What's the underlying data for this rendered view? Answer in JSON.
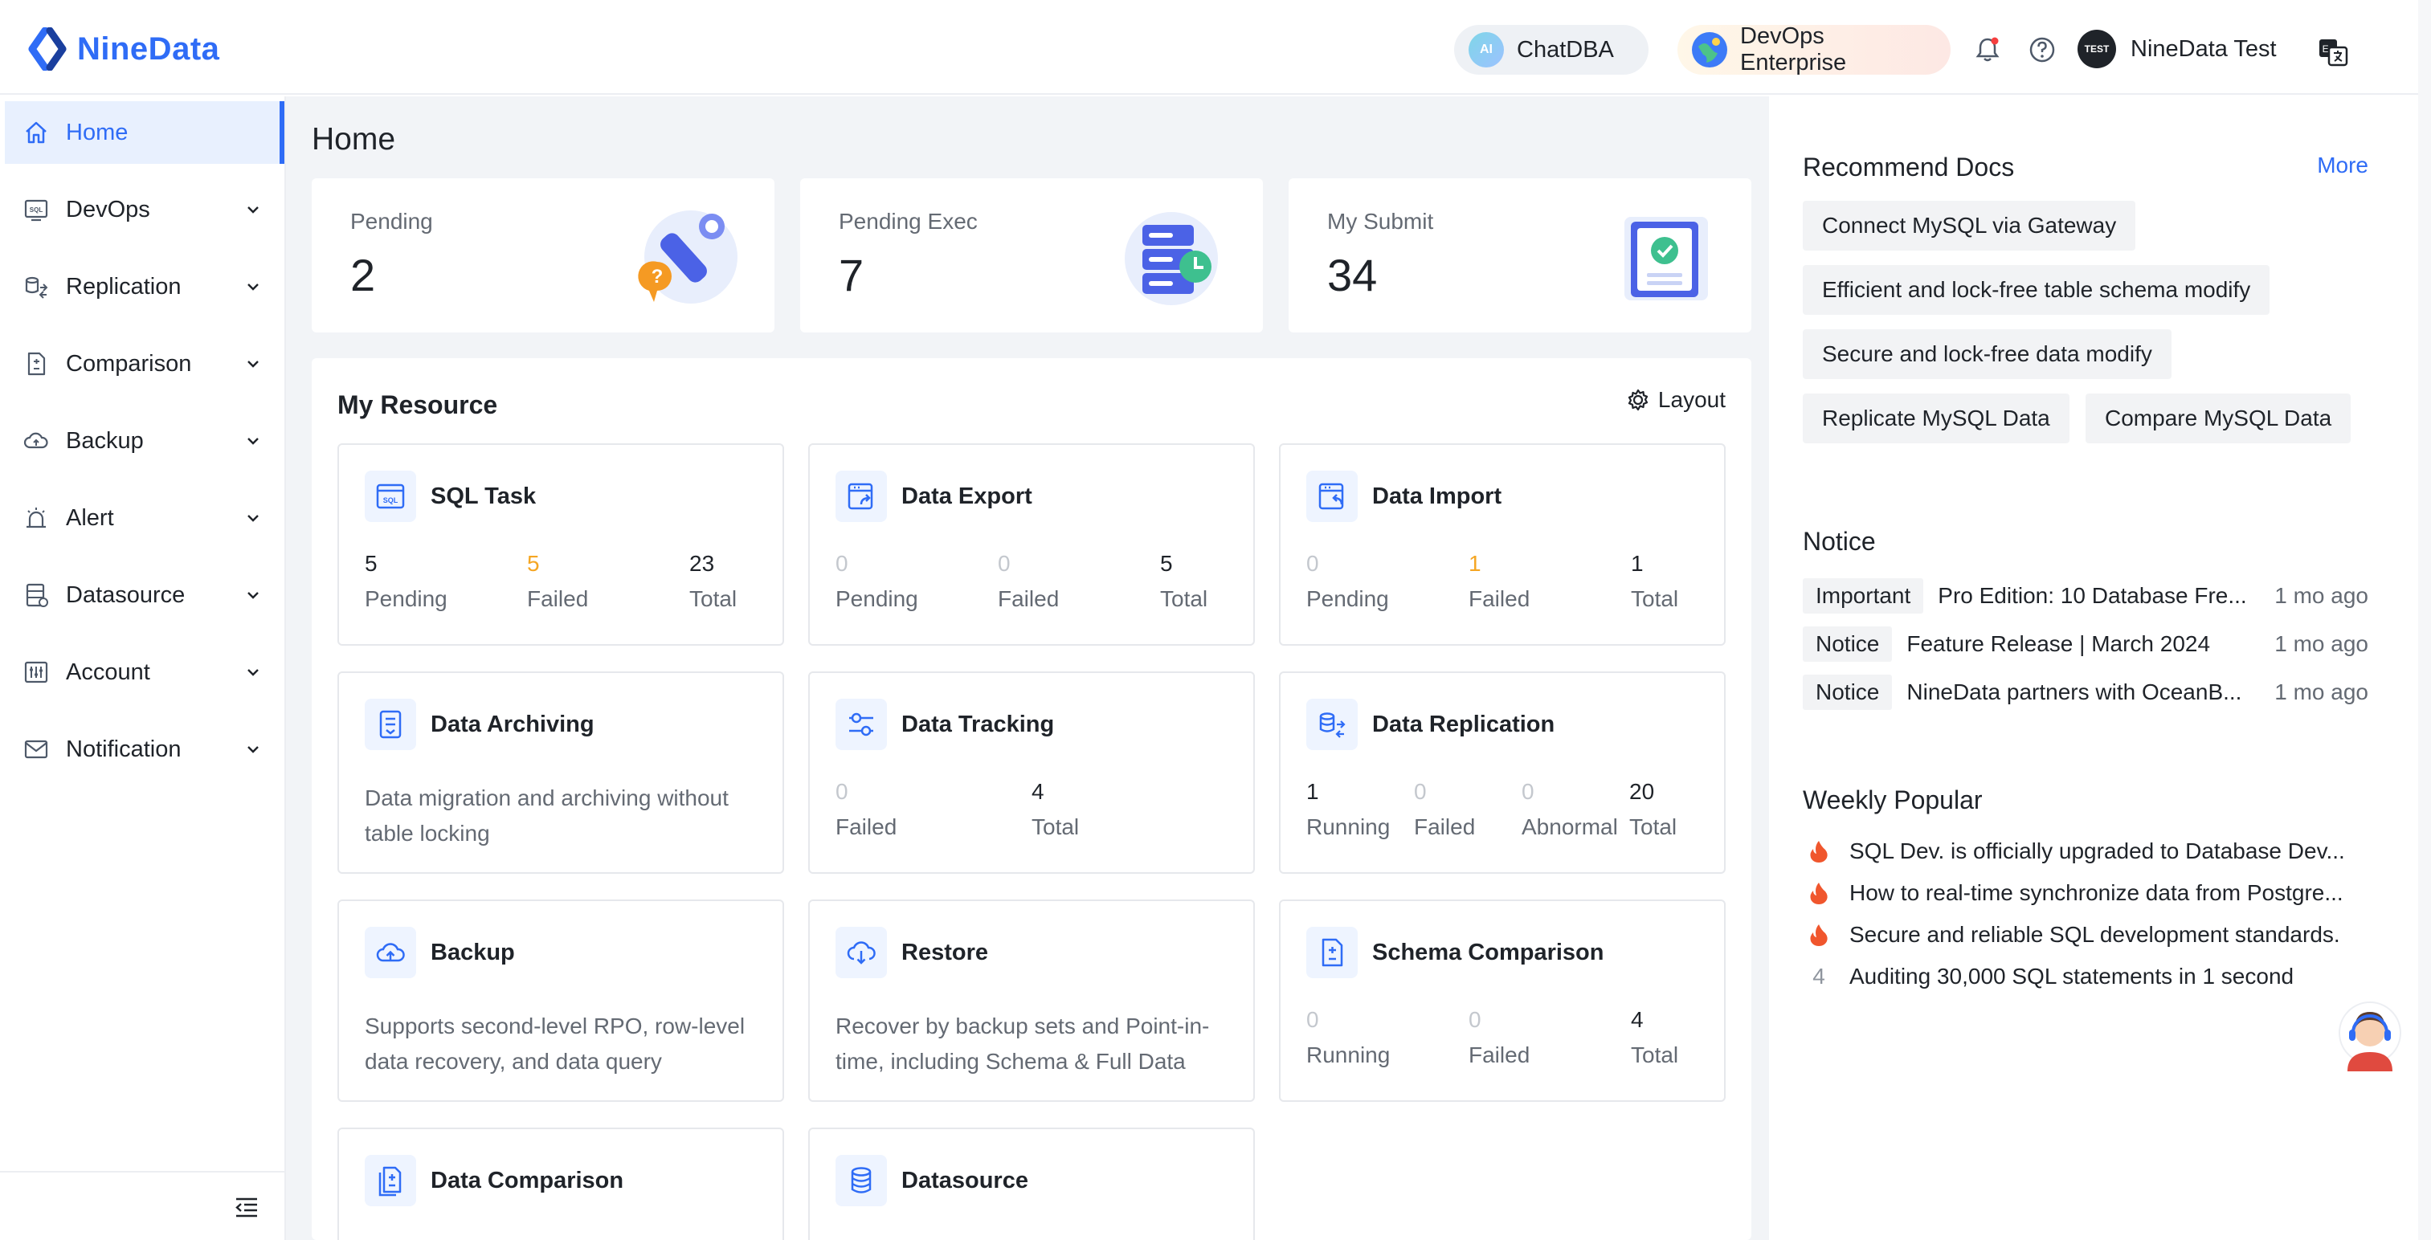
{
  "header": {
    "brand": "NineData",
    "chatdba": {
      "badge": "AI",
      "label": "ChatDBA"
    },
    "edition": "DevOps Enterprise",
    "user": {
      "avatar_text": "TEST",
      "name": "NineData Test"
    }
  },
  "sidebar": {
    "items": [
      {
        "label": "Home",
        "icon": "home-icon",
        "active": true
      },
      {
        "label": "DevOps",
        "icon": "sql-icon"
      },
      {
        "label": "Replication",
        "icon": "replication-icon"
      },
      {
        "label": "Comparison",
        "icon": "comparison-icon"
      },
      {
        "label": "Backup",
        "icon": "cloud-backup-icon"
      },
      {
        "label": "Alert",
        "icon": "alarm-icon"
      },
      {
        "label": "Datasource",
        "icon": "datasource-icon"
      },
      {
        "label": "Account",
        "icon": "account-icon"
      },
      {
        "label": "Notification",
        "icon": "mail-icon"
      }
    ]
  },
  "page": {
    "title": "Home"
  },
  "stats": [
    {
      "label": "Pending",
      "value": "2"
    },
    {
      "label": "Pending Exec",
      "value": "7"
    },
    {
      "label": "My Submit",
      "value": "34"
    }
  ],
  "resource": {
    "title": "My Resource",
    "layout_label": "Layout",
    "tiles": {
      "sql_task": {
        "title": "SQL Task",
        "metrics": [
          {
            "value": "5",
            "label": "Pending"
          },
          {
            "value": "5",
            "label": "Failed"
          },
          {
            "value": "23",
            "label": "Total"
          }
        ]
      },
      "data_export": {
        "title": "Data Export",
        "metrics": [
          {
            "value": "0",
            "label": "Pending"
          },
          {
            "value": "0",
            "label": "Failed"
          },
          {
            "value": "5",
            "label": "Total"
          }
        ]
      },
      "data_import": {
        "title": "Data Import",
        "metrics": [
          {
            "value": "0",
            "label": "Pending"
          },
          {
            "value": "1",
            "label": "Failed"
          },
          {
            "value": "1",
            "label": "Total"
          }
        ]
      },
      "data_archiving": {
        "title": "Data Archiving",
        "desc": "Data migration and archiving without table locking"
      },
      "data_tracking": {
        "title": "Data Tracking",
        "metrics": [
          {
            "value": "0",
            "label": "Failed"
          },
          {
            "value": "4",
            "label": "Total"
          }
        ]
      },
      "data_replication": {
        "title": "Data Replication",
        "metrics": [
          {
            "value": "1",
            "label": "Running"
          },
          {
            "value": "0",
            "label": "Failed"
          },
          {
            "value": "0",
            "label": "Abnormal"
          },
          {
            "value": "20",
            "label": "Total"
          }
        ]
      },
      "backup": {
        "title": "Backup",
        "desc": "Supports second-level RPO, row-level data recovery, and data query"
      },
      "restore": {
        "title": "Restore",
        "desc": "Recover by backup sets and Point-in-time, including Schema & Full Data"
      },
      "schema_comparison": {
        "title": "Schema Comparison",
        "metrics": [
          {
            "value": "0",
            "label": "Running"
          },
          {
            "value": "0",
            "label": "Failed"
          },
          {
            "value": "4",
            "label": "Total"
          }
        ]
      },
      "data_comparison": {
        "title": "Data Comparison"
      },
      "datasource": {
        "title": "Datasource"
      }
    }
  },
  "recommend_docs": {
    "title": "Recommend Docs",
    "more": "More",
    "items": [
      "Connect MySQL via Gateway",
      "Efficient and lock-free table schema modify",
      "Secure and lock-free data modify",
      "Replicate MySQL Data",
      "Compare MySQL Data"
    ]
  },
  "notice": {
    "title": "Notice",
    "items": [
      {
        "tag": "Important",
        "text": "Pro Edition: 10 Database Fre...",
        "time": "1 mo ago"
      },
      {
        "tag": "Notice",
        "text": "Feature Release | March 2024",
        "time": "1 mo ago"
      },
      {
        "tag": "Notice",
        "text": "NineData partners with OceanB...",
        "time": "1 mo ago"
      }
    ]
  },
  "weekly_popular": {
    "title": "Weekly Popular",
    "items": [
      {
        "rank": "fire-icon",
        "text": "SQL Dev. is officially upgraded to Database Dev..."
      },
      {
        "rank": "fire-icon",
        "text": "How to real-time synchronize data from Postgre..."
      },
      {
        "rank": "fire-icon",
        "text": "Secure and reliable SQL development standards."
      },
      {
        "rank": "4",
        "text": "Auditing 30,000 SQL statements in 1 second"
      }
    ]
  },
  "colors": {
    "accent": "#2f6cf6",
    "warning": "#f5a623",
    "fire": "#f0562d",
    "muted": "#c4c8ce"
  }
}
